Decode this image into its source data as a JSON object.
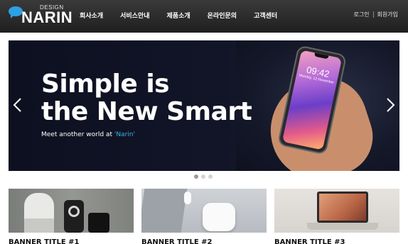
{
  "brand": {
    "small": "DESIGN",
    "name": "NARIN",
    "accent_color": "#2ea0e6"
  },
  "nav": {
    "items": [
      {
        "label": "회사소개"
      },
      {
        "label": "서비스안내"
      },
      {
        "label": "제품소개"
      },
      {
        "label": "온라인문의"
      },
      {
        "label": "고객센터"
      }
    ]
  },
  "util": {
    "login": "로그인",
    "signup": "회원가입"
  },
  "banner": {
    "title": "Simple is\nthe New Smart",
    "subtitle_prefix": "Meet another world at ",
    "subtitle_accent": "'Narin'",
    "phone_time": "09:42",
    "phone_date": "Monday, 12 November",
    "accent_color": "#37b6e8",
    "prev_icon": "chevron-left-icon",
    "next_icon": "chevron-right-icon",
    "slides": 3,
    "active_slide": 1
  },
  "cards": [
    {
      "title": "BANNER TITLE #1"
    },
    {
      "title": "BANNER TITLE #2"
    },
    {
      "title": "BANNER TITLE #3"
    }
  ]
}
